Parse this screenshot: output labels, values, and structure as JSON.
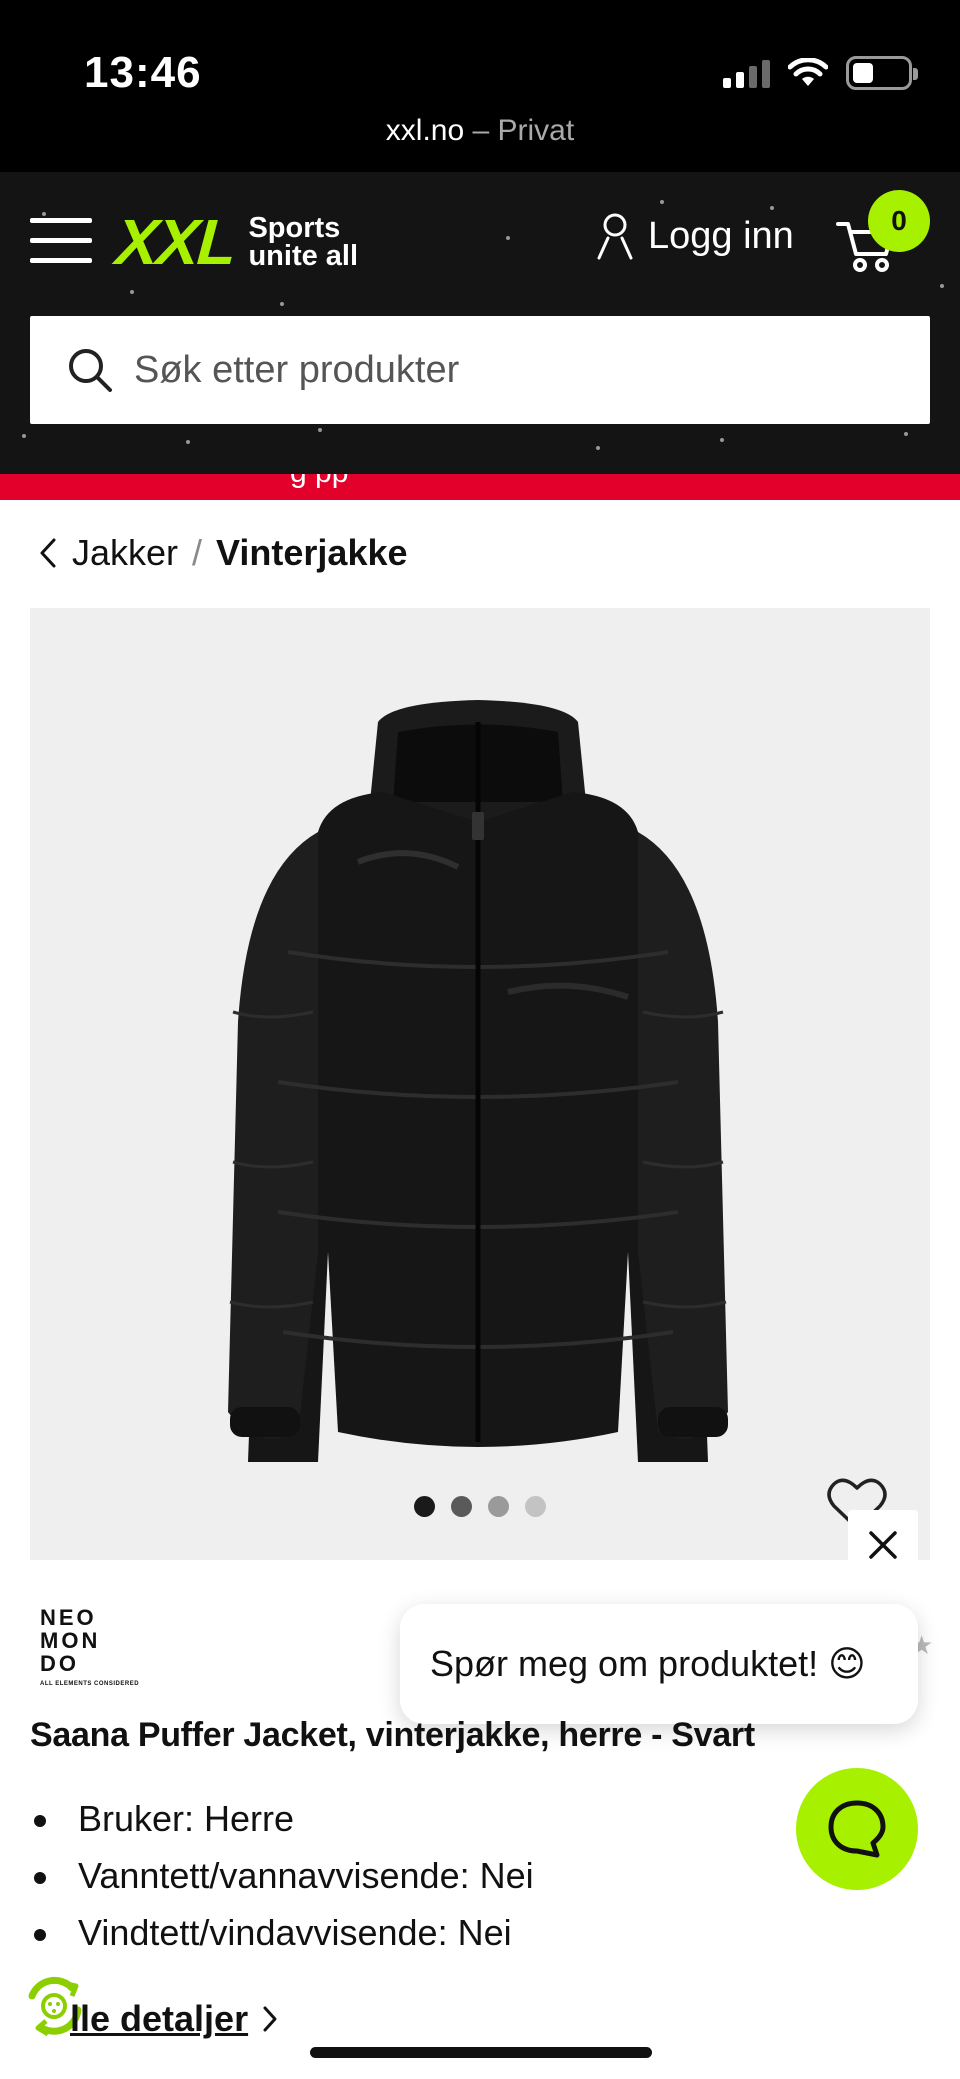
{
  "status_bar": {
    "time": "13:46",
    "url": "xxl.no",
    "mode": "– Privat"
  },
  "header": {
    "logo_main": "XXL",
    "logo_tagline_1": "Sports",
    "logo_tagline_2": "unite all",
    "login_label": "Logg inn",
    "cart_count": "0",
    "search_placeholder": "Søk etter produkter",
    "colors": {
      "background": "#141414",
      "accent": "#a6f000"
    }
  },
  "promo_banner": {
    "text": "g  pp    ",
    "link_text": "          ",
    "color": "#e3002b"
  },
  "breadcrumb": {
    "parent": "Jakker",
    "separator": "/",
    "current": "Vinterjakke"
  },
  "gallery": {
    "image_subject": "black puffer jacket",
    "total_images": 4,
    "active_index": 0
  },
  "chat": {
    "prompt": "Spør meg om produktet! 😊"
  },
  "product": {
    "brand_logo_lines": [
      "NEO",
      "MON",
      "DO"
    ],
    "brand_logo_subtitle": "ALL ELEMENTS CONSIDERED",
    "title": "Saana Puffer Jacket, vinterjakke, herre - Svart",
    "features": [
      "Bruker: Herre",
      "Vanntett/vannavvisende: Nei",
      "Vindtett/vindavvisende: Nei"
    ],
    "all_details_link": "lle detaljer"
  }
}
